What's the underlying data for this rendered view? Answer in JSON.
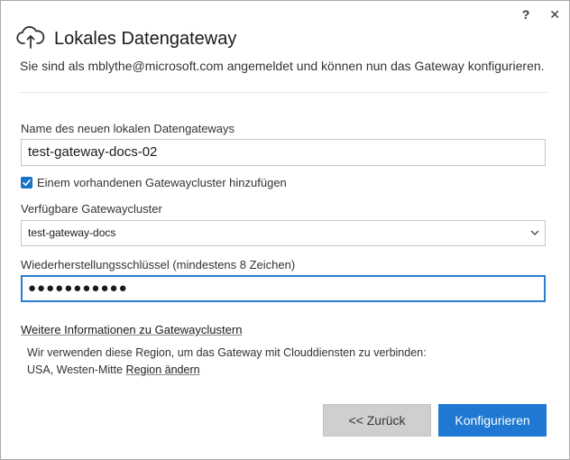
{
  "window": {
    "help_label": "?",
    "close_label": "✕"
  },
  "header": {
    "icon": "cloud-upload-icon",
    "title": "Lokales Datengateway"
  },
  "subtitle": "Sie sind als mblythe@microsoft.com angemeldet und können nun das Gateway konfigurieren.",
  "form": {
    "name_label": "Name des neuen lokalen Datengateways",
    "name_value": "test-gateway-docs-02",
    "add_to_cluster_label": "Einem vorhandenen Gatewaycluster hinzufügen",
    "add_to_cluster_checked": true,
    "clusters_label": "Verfügbare Gatewaycluster",
    "clusters_selected": "test-gateway-docs",
    "recovery_key_label": "Wiederherstellungsschlüssel (mindestens 8 Zeichen)",
    "recovery_key_value": "●●●●●●●●●●●"
  },
  "info": {
    "more_info_link": "Weitere Informationen zu Gatewayclustern",
    "region_text": "Wir verwenden diese Region, um das Gateway mit Clouddiensten zu verbinden:",
    "region_value": "USA, Westen-Mitte",
    "change_region_link": "Region ändern"
  },
  "buttons": {
    "back_label": "<< Zurück",
    "configure_label": "Konfigurieren"
  },
  "colors": {
    "accent": "#1f78d1",
    "focus_border": "#2b7cd3",
    "secondary_button": "#cfcfcf"
  }
}
